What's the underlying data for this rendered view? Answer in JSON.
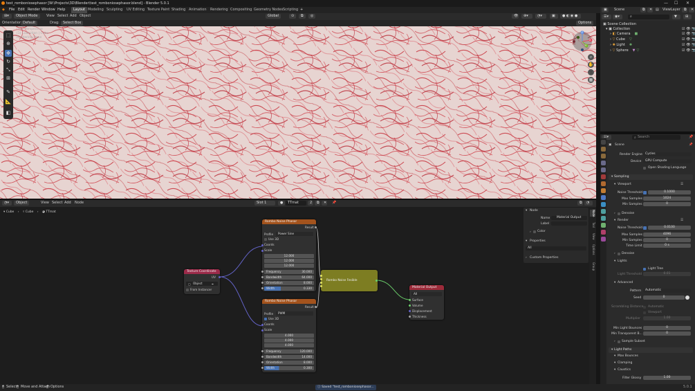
{
  "window": {
    "title": "test_romboniosephasor [W:\\Projects\\3D\\Blender\\test_romboniosephasor.blend] - Blender 5.0.1",
    "min": "—",
    "max": "☐",
    "close": "✕"
  },
  "menu": [
    "File",
    "Edit",
    "Render",
    "Window",
    "Help"
  ],
  "workspaces": [
    "Layout",
    "Modeling",
    "Sculpting",
    "UV Editing",
    "Texture Paint",
    "Shading",
    "Animation",
    "Rendering",
    "Compositing",
    "Geometry Nodes",
    "Scripting"
  ],
  "workspace_add": "+",
  "scene": {
    "label": "Scene",
    "viewlayer": "ViewLayer"
  },
  "viewport": {
    "mode": "Object Mode",
    "view": "View",
    "select": "Select",
    "add": "Add",
    "object": "Object",
    "orientation_label": "Orientation:",
    "orientation": "Default",
    "drag_label": "Drag:",
    "drag": "Select Box",
    "transform": "Global",
    "options": "Options",
    "overlay_text": [
      "User Perspective",
      "(1) Collection | Cube",
      "Rendering Done"
    ]
  },
  "gizmo": {
    "x": "X",
    "y": "Y",
    "z": "Z"
  },
  "node_editor": {
    "editor": "Object",
    "menus": [
      "View",
      "Select",
      "Add",
      "Node"
    ],
    "slot": "Slot 1",
    "material": "TTmat",
    "users": "2",
    "breadcrumb": [
      "Cube",
      "Cube",
      "TTmat"
    ]
  },
  "nodes": {
    "phasor1": {
      "title": "Rombo Noise Phasor",
      "result": "Result",
      "profile_label": "Profile",
      "profile": "Power Sine",
      "use3d": "Use 3D",
      "coords": "Coords",
      "scale": "Scale",
      "scale_vals": [
        "12.000",
        "12.000",
        "12.000"
      ],
      "fields": [
        {
          "k": "Frequency",
          "v": "30.000"
        },
        {
          "k": "Bandwidth",
          "v": "64.000"
        },
        {
          "k": "Orientation",
          "v": "8.000"
        },
        {
          "k": "Width",
          "v": "0.330"
        }
      ]
    },
    "phasor2": {
      "title": "Rombo Noise Phasor",
      "result": "Result",
      "profile_label": "Profile",
      "profile": "PWM",
      "use3d": "Use 3D",
      "coords": "Coords",
      "scale": "Scale",
      "scale_vals": [
        "4.000",
        "4.000",
        "4.000"
      ],
      "fields": [
        {
          "k": "Frequency",
          "v": "120.000"
        },
        {
          "k": "Bandwidth",
          "v": "14.000"
        },
        {
          "k": "Orientation",
          "v": "8.000"
        },
        {
          "k": "Width",
          "v": "0.300"
        }
      ]
    },
    "texcoord": {
      "title": "Texture Coordinate",
      "uv": "UV",
      "object": "Object",
      "instancer": "From Instancer"
    },
    "fesible": {
      "title": "Rombo Noise Fesible"
    },
    "output": {
      "title": "Material Output",
      "target": "All",
      "inputs": [
        "Surface",
        "Volume",
        "Displacement",
        "Thickness"
      ]
    }
  },
  "npanel": {
    "section_node": "Node",
    "name_label": "Name",
    "name_value": "Material Output",
    "label_label": "Label",
    "color": "Color",
    "properties": "Properties",
    "prop_value": "All",
    "custom": "Custom Properties"
  },
  "ntabs": [
    "Node",
    "Tool",
    "View",
    "Options",
    "Group"
  ],
  "outliner": {
    "header": "Scene Collection",
    "items": [
      "Collection",
      "Camera",
      "Cube",
      "Light",
      "Sphere"
    ]
  },
  "props": {
    "search_placeholder": "Search",
    "scene": "Scene",
    "engine_label": "Render Engine",
    "engine": "Cycles",
    "device_label": "Device",
    "device": "GPU Compute",
    "osl": "Open Shading Language",
    "sampling": "Sampling",
    "viewport": "Viewport",
    "noise_threshold": "Noise Threshold",
    "vp_noise": "0.1000",
    "max_samples": "Max Samples",
    "vp_max": "1024",
    "min_samples": "Min Samples",
    "vp_min": "0",
    "denoise": "Denoise",
    "render": "Render",
    "r_noise": "0.0100",
    "r_max": "4096",
    "r_min": "0",
    "time_limit": "Time Limit",
    "r_time": "0 s",
    "lights": "Lights",
    "light_tree": "Light Tree",
    "light_threshold": "Light Threshold",
    "lt_val": "0.01",
    "advanced": "Advanced",
    "pattern_label": "Pattern",
    "pattern": "Automatic",
    "seed_label": "Seed",
    "seed": "0",
    "scrambling": "Scrambling Distance",
    "automatic": "Automatic",
    "viewport2": "Viewport",
    "multiplier": "Multiplier",
    "mult": "1.00",
    "min_light_bounces": "Min Light Bounces",
    "mlb": "0",
    "min_transparent": "Min Transparent B...",
    "mtb": "0",
    "subset": "Sample Subset",
    "light_paths": "Light Paths",
    "max_bounces": "Max Bounces",
    "clamping": "Clamping",
    "caustics": "Caustics",
    "filter_glossy": "Filter Glossy",
    "fg": "1.00"
  },
  "status": {
    "select": "Select",
    "move": "Move and Attach",
    "options": "Options",
    "saved": "Saved \"test_romboniosephasor...",
    "version": "5.0.1"
  }
}
